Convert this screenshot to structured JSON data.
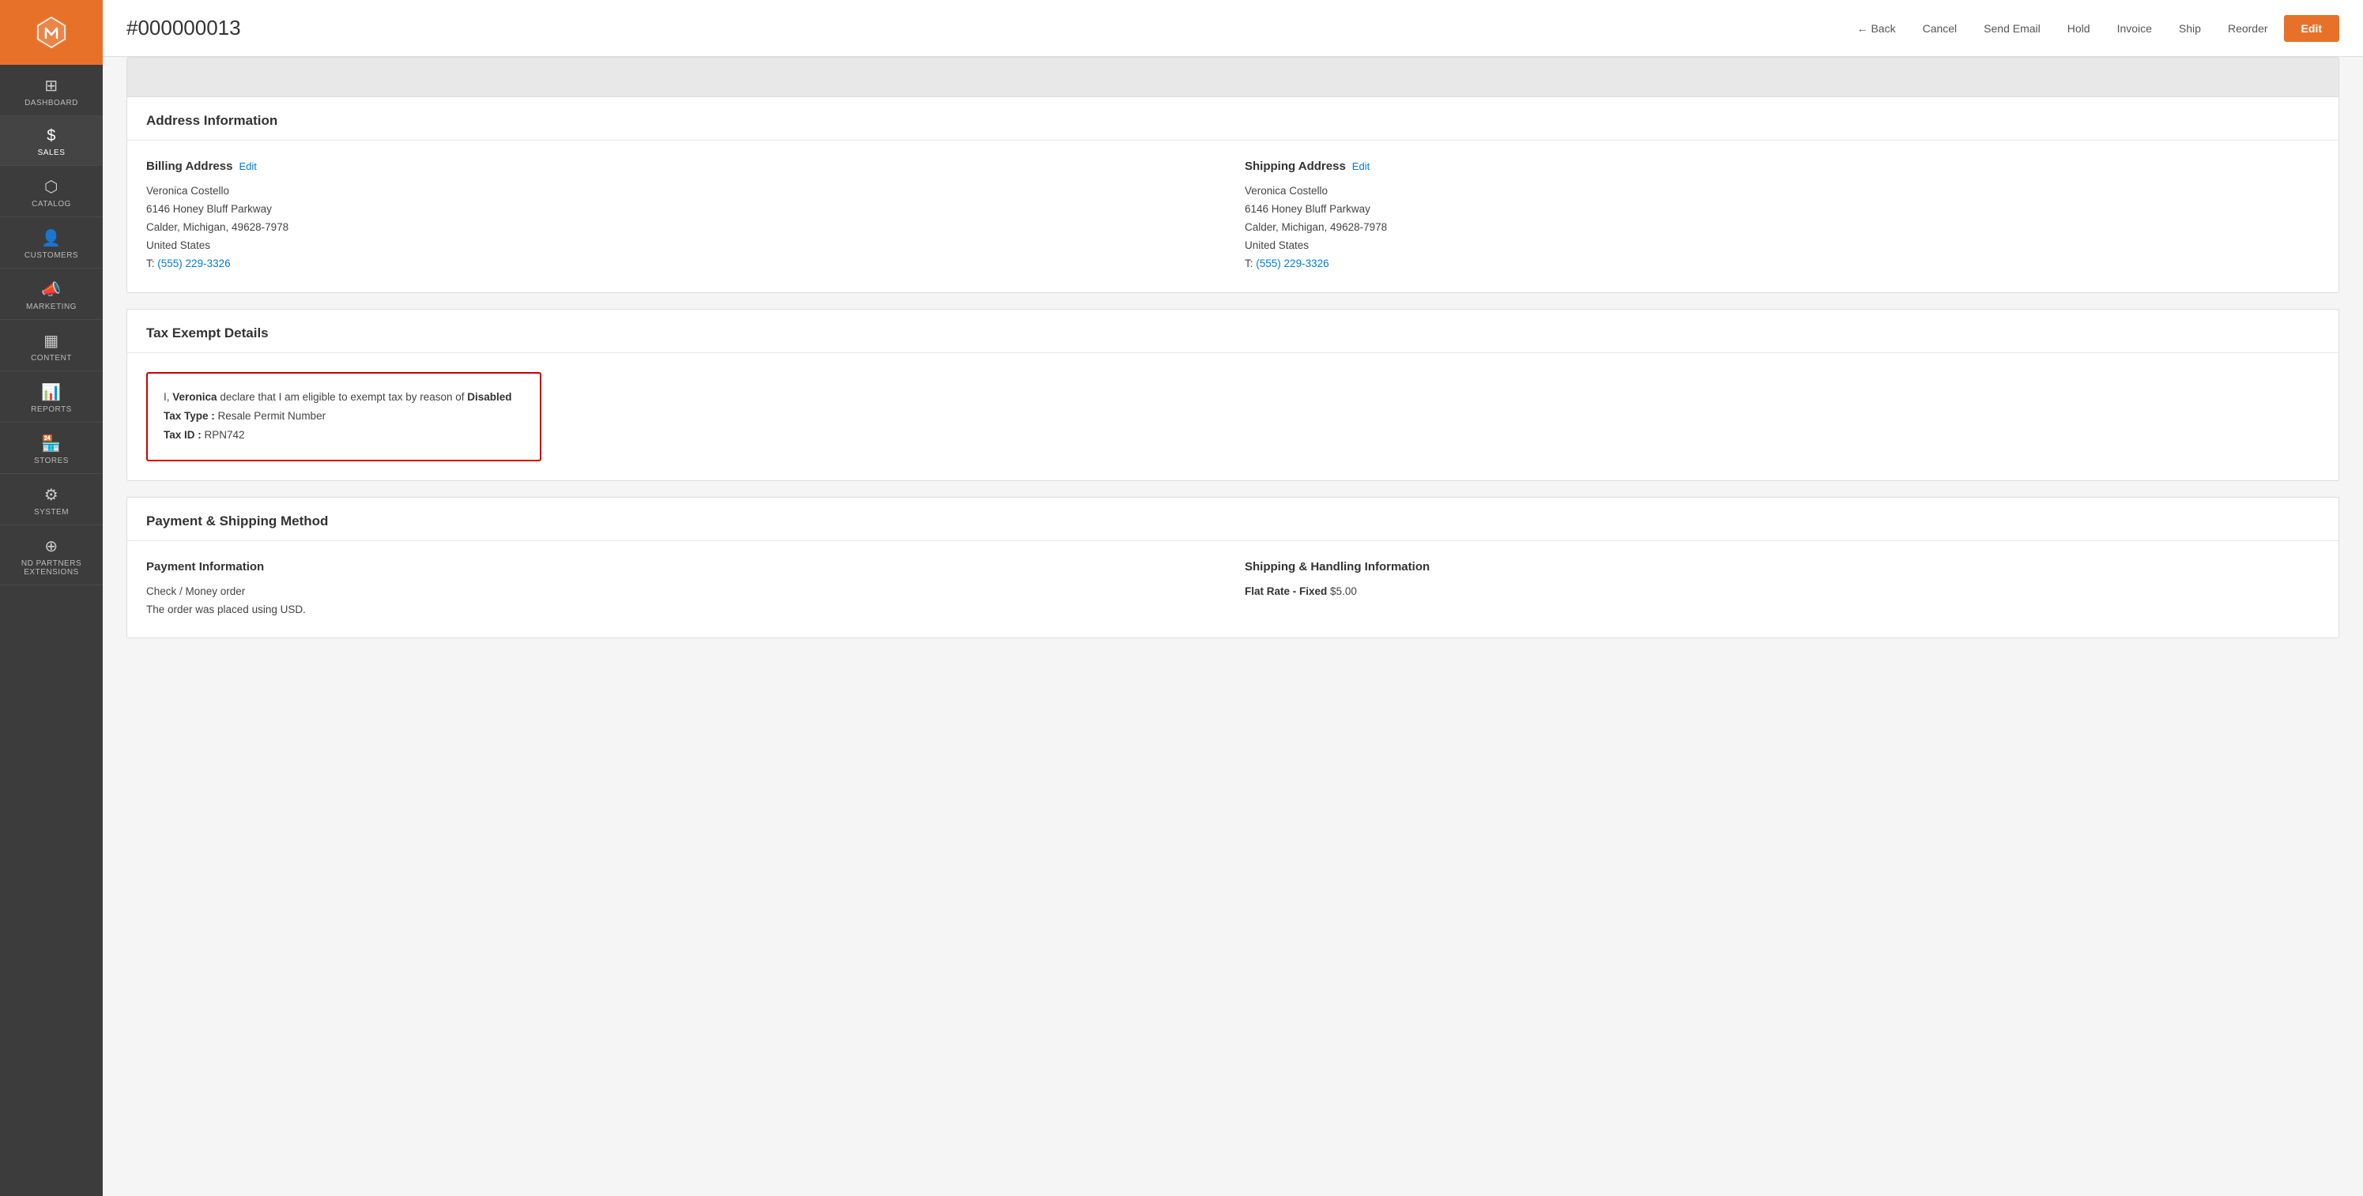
{
  "sidebar": {
    "logo_alt": "Magento Logo",
    "items": [
      {
        "id": "dashboard",
        "label": "DASHBOARD",
        "icon": "⊞"
      },
      {
        "id": "sales",
        "label": "SALES",
        "icon": "$",
        "active": true
      },
      {
        "id": "catalog",
        "label": "CATALOG",
        "icon": "⬡"
      },
      {
        "id": "customers",
        "label": "CUSTOMERS",
        "icon": "👤"
      },
      {
        "id": "marketing",
        "label": "MARKETING",
        "icon": "📣"
      },
      {
        "id": "content",
        "label": "CONTENT",
        "icon": "▦"
      },
      {
        "id": "reports",
        "label": "REPORTS",
        "icon": "📊"
      },
      {
        "id": "stores",
        "label": "STORES",
        "icon": "🏪"
      },
      {
        "id": "system",
        "label": "SYSTEM",
        "icon": "⚙"
      },
      {
        "id": "partners",
        "label": "ND PARTNERS EXTENSIONS",
        "icon": "⊕"
      }
    ]
  },
  "header": {
    "title": "#000000013",
    "back_label": "← Back",
    "cancel_label": "Cancel",
    "send_email_label": "Send Email",
    "hold_label": "Hold",
    "invoice_label": "Invoice",
    "ship_label": "Ship",
    "reorder_label": "Reorder",
    "edit_label": "Edit"
  },
  "address_section": {
    "title": "Address Information",
    "billing": {
      "heading": "Billing Address",
      "edit_label": "Edit",
      "name": "Veronica Costello",
      "street": "6146 Honey Bluff Parkway",
      "city_state_zip": "Calder, Michigan, 49628-7978",
      "country": "United States",
      "phone_label": "T:",
      "phone": "(555) 229-3326"
    },
    "shipping": {
      "heading": "Shipping Address",
      "edit_label": "Edit",
      "name": "Veronica Costello",
      "street": "6146 Honey Bluff Parkway",
      "city_state_zip": "Calder, Michigan, 49628-7978",
      "country": "United States",
      "phone_label": "T:",
      "phone": "(555) 229-3326"
    }
  },
  "tax_section": {
    "title": "Tax Exempt Details",
    "declaration_pre": "I,",
    "customer_name": "Veronica",
    "declaration_mid": "declare that I am eligible to exempt tax by reason of",
    "reason": "Disabled",
    "tax_type_label": "Tax Type :",
    "tax_type_value": "Resale Permit Number",
    "tax_id_label": "Tax ID :",
    "tax_id_value": "RPN742"
  },
  "payment_section": {
    "title": "Payment & Shipping Method",
    "payment": {
      "heading": "Payment Information",
      "method": "Check / Money order",
      "note": "The order was placed using USD."
    },
    "shipping": {
      "heading": "Shipping & Handling Information",
      "rate_label": "Flat Rate - Fixed",
      "rate_value": "$5.00"
    }
  }
}
